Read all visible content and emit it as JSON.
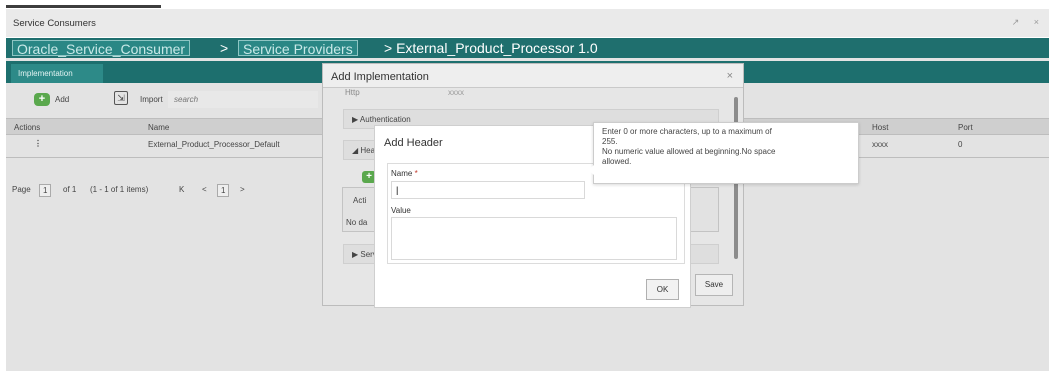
{
  "window": {
    "title": "Service Consumers",
    "controls": "↗ ×"
  },
  "breadcrumb": {
    "consumer": "Oracle_Service_Consumer",
    "sep1": ">",
    "providers": "Service Providers",
    "sep2": "> External_Product_Processor 1.0"
  },
  "tabs": [
    {
      "label": "Implementation"
    }
  ],
  "toolbar": {
    "add_label": "Add",
    "import_label": "Import",
    "search_placeholder": "search"
  },
  "grid": {
    "columns": [
      "Actions",
      "Name",
      "Host",
      "Port"
    ],
    "rows": [
      {
        "actions": "⋮",
        "name": "External_Product_Processor_Default",
        "host": "xxxx",
        "port": "0"
      }
    ]
  },
  "pager": {
    "page_label": "Page",
    "page_value": "1",
    "of_label": "of 1",
    "items": "(1 - 1 of 1 items)",
    "first": "K",
    "prev": "<",
    "current": "1",
    "next": ">"
  },
  "add_implementation_dialog": {
    "title": "Add Implementation",
    "close": "×",
    "partial_row": "Http",
    "partial_value": "xxxx",
    "sections": {
      "authentication": "▶ Authentication",
      "headers": "◢ Hea",
      "service": "▶ Serv"
    },
    "table_header": "Acti",
    "table_empty": "No da",
    "save_label": "Save"
  },
  "add_header_dialog": {
    "title": "Add Header",
    "name_label": "Name",
    "required_mark": "*",
    "name_value": "|",
    "value_label": "Value",
    "ok_label": "OK"
  },
  "tooltip": {
    "line1": "Enter 0 or more characters, up to a maximum of",
    "line2": "255.",
    "line3": "No numeric value allowed at beginning.No space",
    "line4": "allowed."
  }
}
